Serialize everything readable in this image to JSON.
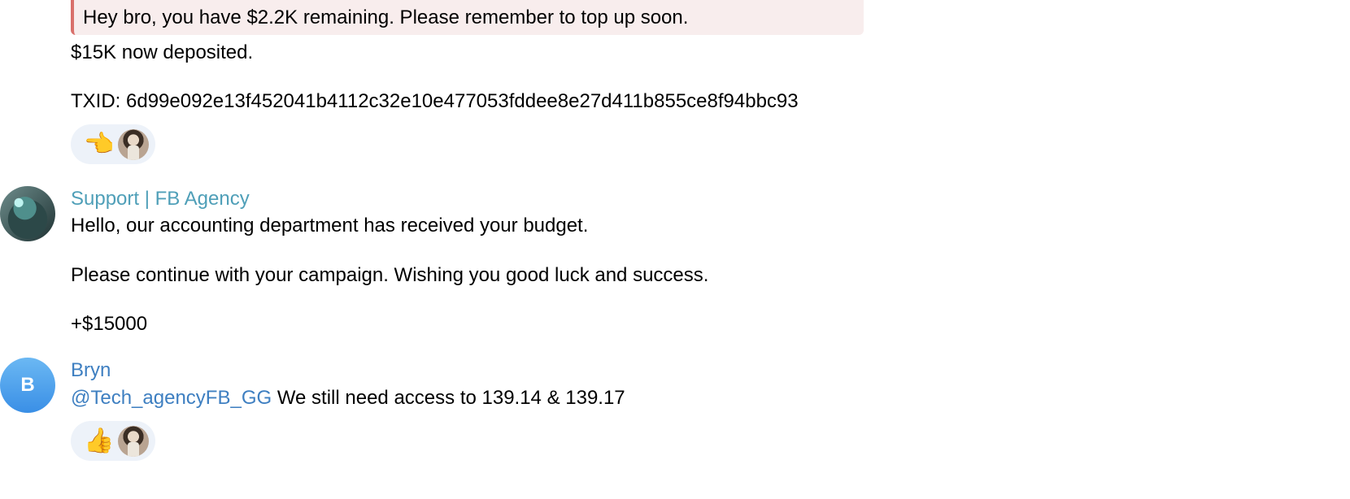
{
  "messages": {
    "quote_text": "Hey bro, you have $2.2K remaining. Please remember to top up soon.",
    "deposit_text": "$15K now deposited.",
    "txid_text": "TXID: 6d99e092e13f452041b4112c32e10e477053fddee8e27d411b855ce8f94bbc93",
    "reaction1_emoji": "👈",
    "support": {
      "sender": "Support | FB Agency",
      "sender_color": "#4f9fb8",
      "line1": "Hello, our accounting department has received your budget.",
      "line2": "Please continue with your campaign. Wishing you good luck and success.",
      "line3": "+$15000"
    },
    "bryn": {
      "sender": "Bryn",
      "sender_color": "#3e7fc1",
      "avatar_initial": "B",
      "mention": "@Tech_agencyFB_GG",
      "text": " We still need access to 139.14 & 139.17",
      "reaction_emoji": "👍"
    }
  }
}
